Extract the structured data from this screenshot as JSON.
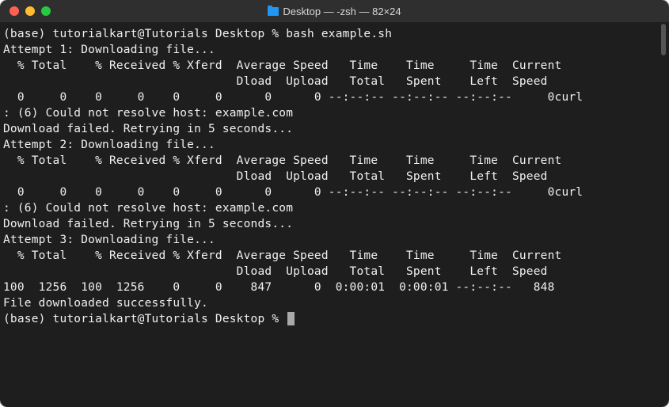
{
  "window": {
    "title": "Desktop — -zsh — 82×24"
  },
  "session": {
    "prompt1": "(base) tutorialkart@Tutorials Desktop % ",
    "command1": "bash example.sh",
    "prompt2": "(base) tutorialkart@Tutorials Desktop % "
  },
  "attempts": {
    "a1_header": "Attempt 1: Downloading file...",
    "a2_header": "Attempt 2: Downloading file...",
    "a3_header": "Attempt 3: Downloading file...",
    "cols_row1": "  % Total    % Received % Xferd  Average Speed   Time    Time     Time  Current",
    "cols_row2": "                                 Dload  Upload   Total   Spent    Left  Speed",
    "fail_row": "  0     0    0     0    0     0      0      0 --:--:-- --:--:-- --:--:--     0curl",
    "err_line": ": (6) Could not resolve host: example.com",
    "retry_line": "Download failed. Retrying in 5 seconds...",
    "success_row": "100  1256  100  1256    0     0    847      0  0:00:01  0:00:01 --:--:--   848",
    "success_msg": "File downloaded successfully."
  }
}
